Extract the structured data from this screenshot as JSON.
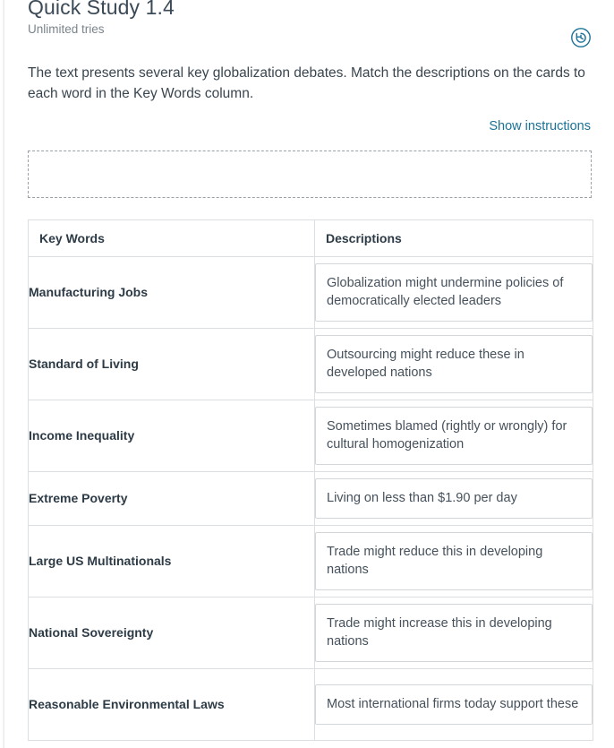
{
  "header": {
    "title": "Quick Study 1.4",
    "tries": "Unlimited tries",
    "reset_icon": "history-restore-icon",
    "reset_label": "Reset activity"
  },
  "intro": {
    "text": "The text presents several key globalization debates. Match the descriptions on the cards to each word in the Key Words column."
  },
  "instructions": {
    "link_label": "Show instructions"
  },
  "dropzone": {
    "label": "Card drop area",
    "cards": []
  },
  "table": {
    "columns": [
      "Key Words",
      "Descriptions"
    ],
    "rows": [
      {
        "key_word": "Manufacturing Jobs",
        "description": "Globalization might undermine policies of democratically elected leaders",
        "lines": 2
      },
      {
        "key_word": "Standard of Living",
        "description": "Outsourcing might reduce these in developed nations",
        "lines": 2
      },
      {
        "key_word": "Income Inequality",
        "description": "Sometimes blamed (rightly or wrongly) for cultural homogenization",
        "lines": 2
      },
      {
        "key_word": "Extreme Poverty",
        "description": "Living on less than $1.90 per day",
        "lines": 1
      },
      {
        "key_word": "Large US Multinationals",
        "description": "Trade might reduce this in developing nations",
        "lines": 2
      },
      {
        "key_word": "National Sovereignty",
        "description": "Trade might increase this in developing nations",
        "lines": 2
      },
      {
        "key_word": "Reasonable Environmental Laws",
        "description": "Most international firms today support these",
        "lines": 2
      }
    ]
  },
  "colors": {
    "link": "#1b7296",
    "icon": "#1b7296",
    "text": "#2f3c47",
    "muted": "#7b848c",
    "border": "#dcdfe2",
    "card_border": "#d3d7da",
    "dropzone_border": "#9aa0a6"
  }
}
